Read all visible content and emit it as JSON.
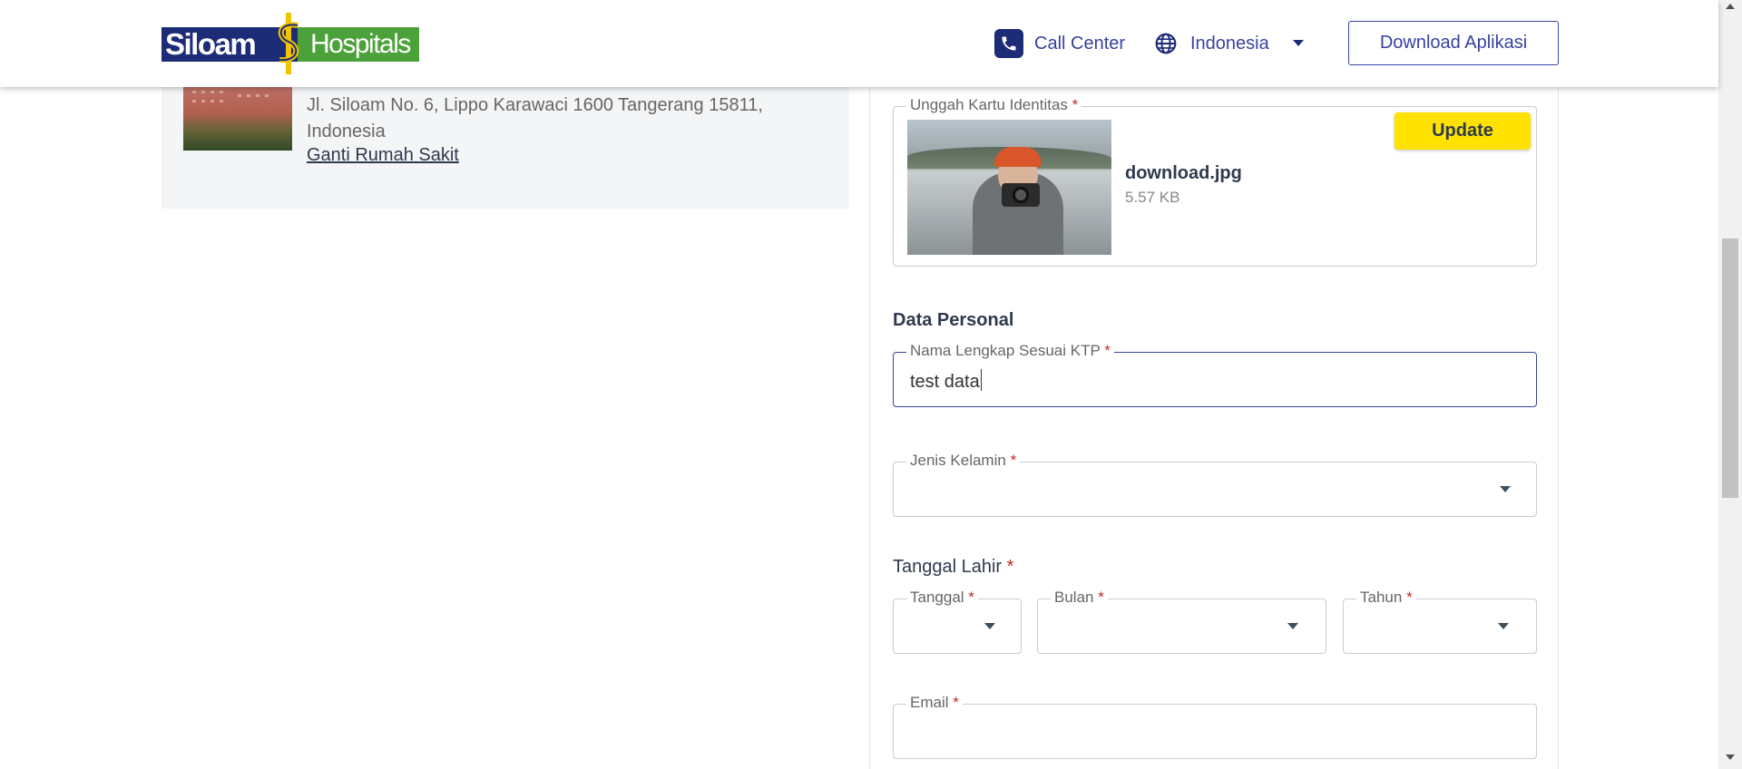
{
  "header": {
    "logo_text_left": "Siloam",
    "logo_text_right": "Hospitals",
    "call_center_label": "Call Center",
    "language_label": "Indonesia",
    "download_button_label": "Download Aplikasi"
  },
  "hospital": {
    "address": "Jl. Siloam No. 6, Lippo Karawaci 1600 Tangerang 15811, Indonesia",
    "change_link": "Ganti Rumah Sakit"
  },
  "form": {
    "upload": {
      "legend": "Unggah Kartu Identitas",
      "file_name": "download.jpg",
      "file_size": "5.57 KB",
      "update_button": "Update"
    },
    "personal_section_title": "Data Personal",
    "full_name": {
      "legend": "Nama Lengkap Sesuai KTP",
      "value": "test data"
    },
    "gender": {
      "legend": "Jenis Kelamin",
      "value": ""
    },
    "dob": {
      "title": "Tanggal Lahir",
      "day_legend": "Tanggal",
      "month_legend": "Bulan",
      "year_legend": "Tahun"
    },
    "email": {
      "legend": "Email",
      "value": ""
    },
    "required_mark": "*"
  },
  "colors": {
    "brand_blue": "#1c2c77",
    "brand_green": "#4ca23a",
    "accent_link": "#3642a0",
    "update_yellow": "#ffe200",
    "required_red": "#c62828"
  }
}
